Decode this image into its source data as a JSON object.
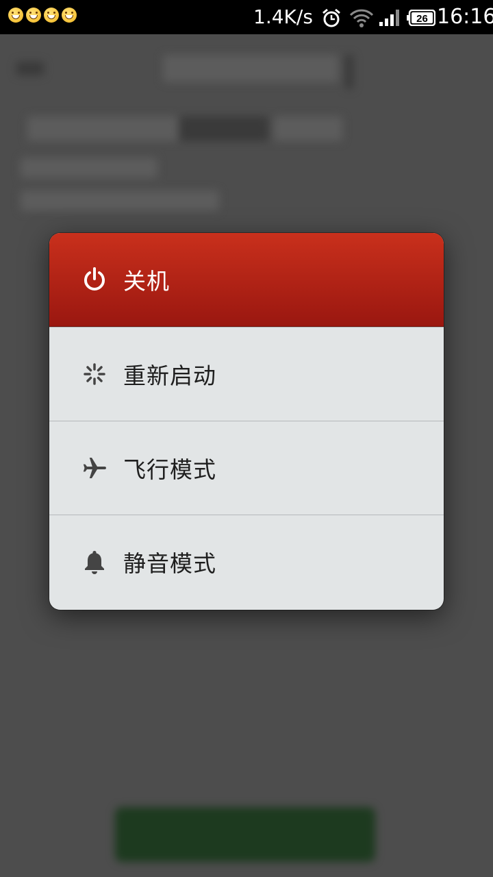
{
  "status_bar": {
    "notification_icons": [
      "grin-emoji-icon",
      "grin-emoji-icon",
      "grin-emoji-icon",
      "grin-emoji-icon"
    ],
    "net_speed": "1.4K/s",
    "battery_level": "26",
    "time": "16:16"
  },
  "power_menu": {
    "items": [
      {
        "label": "关机",
        "icon": "power-icon"
      },
      {
        "label": "重新启动",
        "icon": "restart-spinner-icon"
      },
      {
        "label": "飞行模式",
        "icon": "airplane-icon"
      },
      {
        "label": "静音模式",
        "icon": "bell-icon"
      }
    ]
  },
  "colors": {
    "shutdown_red": "#b8231a",
    "menu_background": "#e2e5e6",
    "overlay": "#4d4d4d"
  }
}
